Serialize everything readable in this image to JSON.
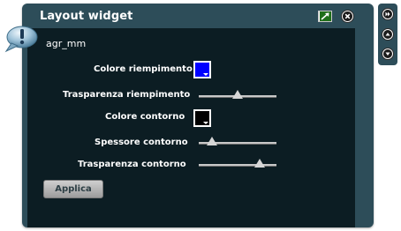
{
  "window": {
    "title": "Layout widget"
  },
  "layer": {
    "name": "agr_mm"
  },
  "form": {
    "fill_color_label": "Colore riempimento",
    "fill_color": "#0000ff",
    "fill_transparency_label": "Trasparenza riempimento",
    "fill_transparency": 0.5,
    "stroke_color_label": "Colore contorno",
    "stroke_color": "#000000",
    "stroke_width_label": "Spessore contorno",
    "stroke_width": 0.17,
    "stroke_transparency_label": "Trasparenza contorno",
    "stroke_transparency": 0.78,
    "apply_label": "Applica"
  },
  "icons": {
    "info": "info-bubble-icon",
    "minimize": "arrow-up-right-icon",
    "close": "close-icon",
    "fast_forward": "double-chevron-right-icon",
    "up": "triangle-up-icon",
    "down": "triangle-down-icon"
  },
  "colors": {
    "frame": "#2d4d59",
    "panel": "#0c1d23",
    "accent_green": "#3aa32d"
  }
}
